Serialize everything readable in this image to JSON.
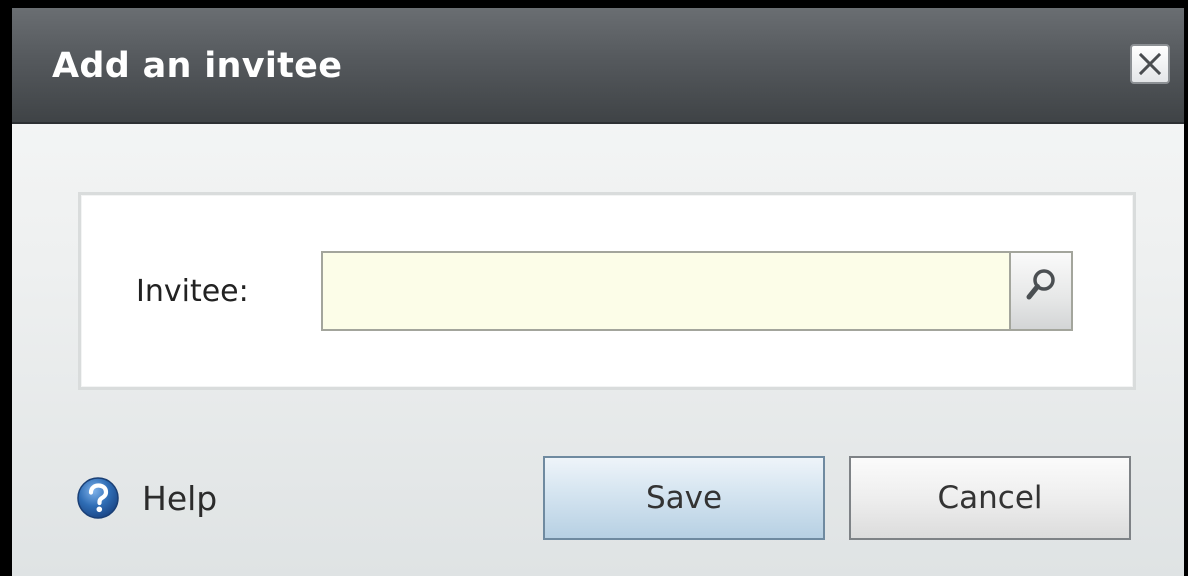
{
  "dialog": {
    "title": "Add an invitee",
    "close_icon": "close-icon"
  },
  "form": {
    "invitee_label": "Invitee:",
    "invitee_value": "",
    "invitee_field_color": "#fcfde8",
    "search_icon": "magnifier-icon"
  },
  "footer": {
    "help_label": "Help",
    "help_icon": "question-circle-icon",
    "save_label": "Save",
    "cancel_label": "Cancel"
  },
  "colors": {
    "titlebar": "#55595d",
    "help_icon_blue": "#2f6db5",
    "save_button": "#c8dceb"
  }
}
